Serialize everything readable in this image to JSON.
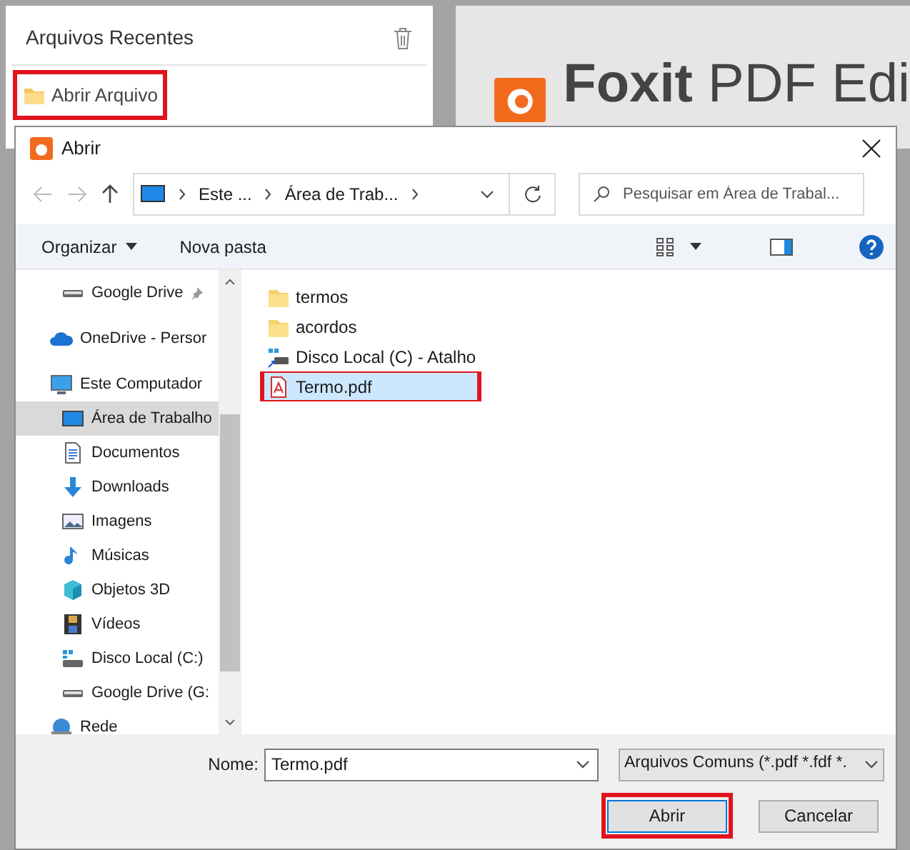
{
  "recent_panel": {
    "title": "Arquivos Recentes",
    "open_button": {
      "label": "Abrir Arquivo",
      "highlighted": true
    }
  },
  "app_logo": {
    "name_bold": "Foxit",
    "name_rest": "PDF Edi"
  },
  "dialog": {
    "title": "Abrir",
    "breadcrumb": [
      "Este ...",
      "Área de Trab..."
    ],
    "search": {
      "placeholder": "Pesquisar em Área de Trabal..."
    },
    "toolbar": [
      "Organizar",
      "Nova pasta"
    ],
    "nav": [
      {
        "label": "Google Drive",
        "kind": "drive",
        "pinned": true,
        "selected": false
      },
      {
        "label": "OneDrive - Persor",
        "kind": "cloud",
        "selected": false
      },
      {
        "label": "Este Computador",
        "kind": "computer",
        "selected": false,
        "children": [
          {
            "label": "Área de Trabalho",
            "kind": "desktop",
            "selected": true
          },
          {
            "label": "Documentos",
            "kind": "document",
            "selected": false
          },
          {
            "label": "Downloads",
            "kind": "download",
            "selected": false
          },
          {
            "label": "Imagens",
            "kind": "image",
            "selected": false
          },
          {
            "label": "Músicas",
            "kind": "music",
            "selected": false
          },
          {
            "label": "Objetos 3D",
            "kind": "cube",
            "selected": false
          },
          {
            "label": "Vídeos",
            "kind": "film",
            "selected": false
          },
          {
            "label": "Disco Local (C:)",
            "kind": "disk",
            "selected": false
          },
          {
            "label": "Google Drive (G:",
            "kind": "drive",
            "selected": false
          }
        ]
      },
      {
        "label": "Rede",
        "kind": "network",
        "selected": false
      }
    ],
    "files": [
      {
        "name": "termos",
        "kind": "folder",
        "selected": false,
        "highlighted": false
      },
      {
        "name": "acordos",
        "kind": "folder",
        "selected": false,
        "highlighted": false
      },
      {
        "name": "Disco Local (C) - Atalho",
        "kind": "shortcut",
        "selected": false,
        "highlighted": false
      },
      {
        "name": "Termo.pdf",
        "kind": "pdf",
        "selected": true,
        "highlighted": true
      }
    ],
    "filename_label": "Nome:",
    "filename": "Termo.pdf",
    "file_type": "Arquivos Comuns (*.pdf *.fdf *.",
    "buttons": [
      {
        "label": "Abrir",
        "highlighted": true
      },
      {
        "label": "Cancelar",
        "highlighted": false
      }
    ]
  }
}
